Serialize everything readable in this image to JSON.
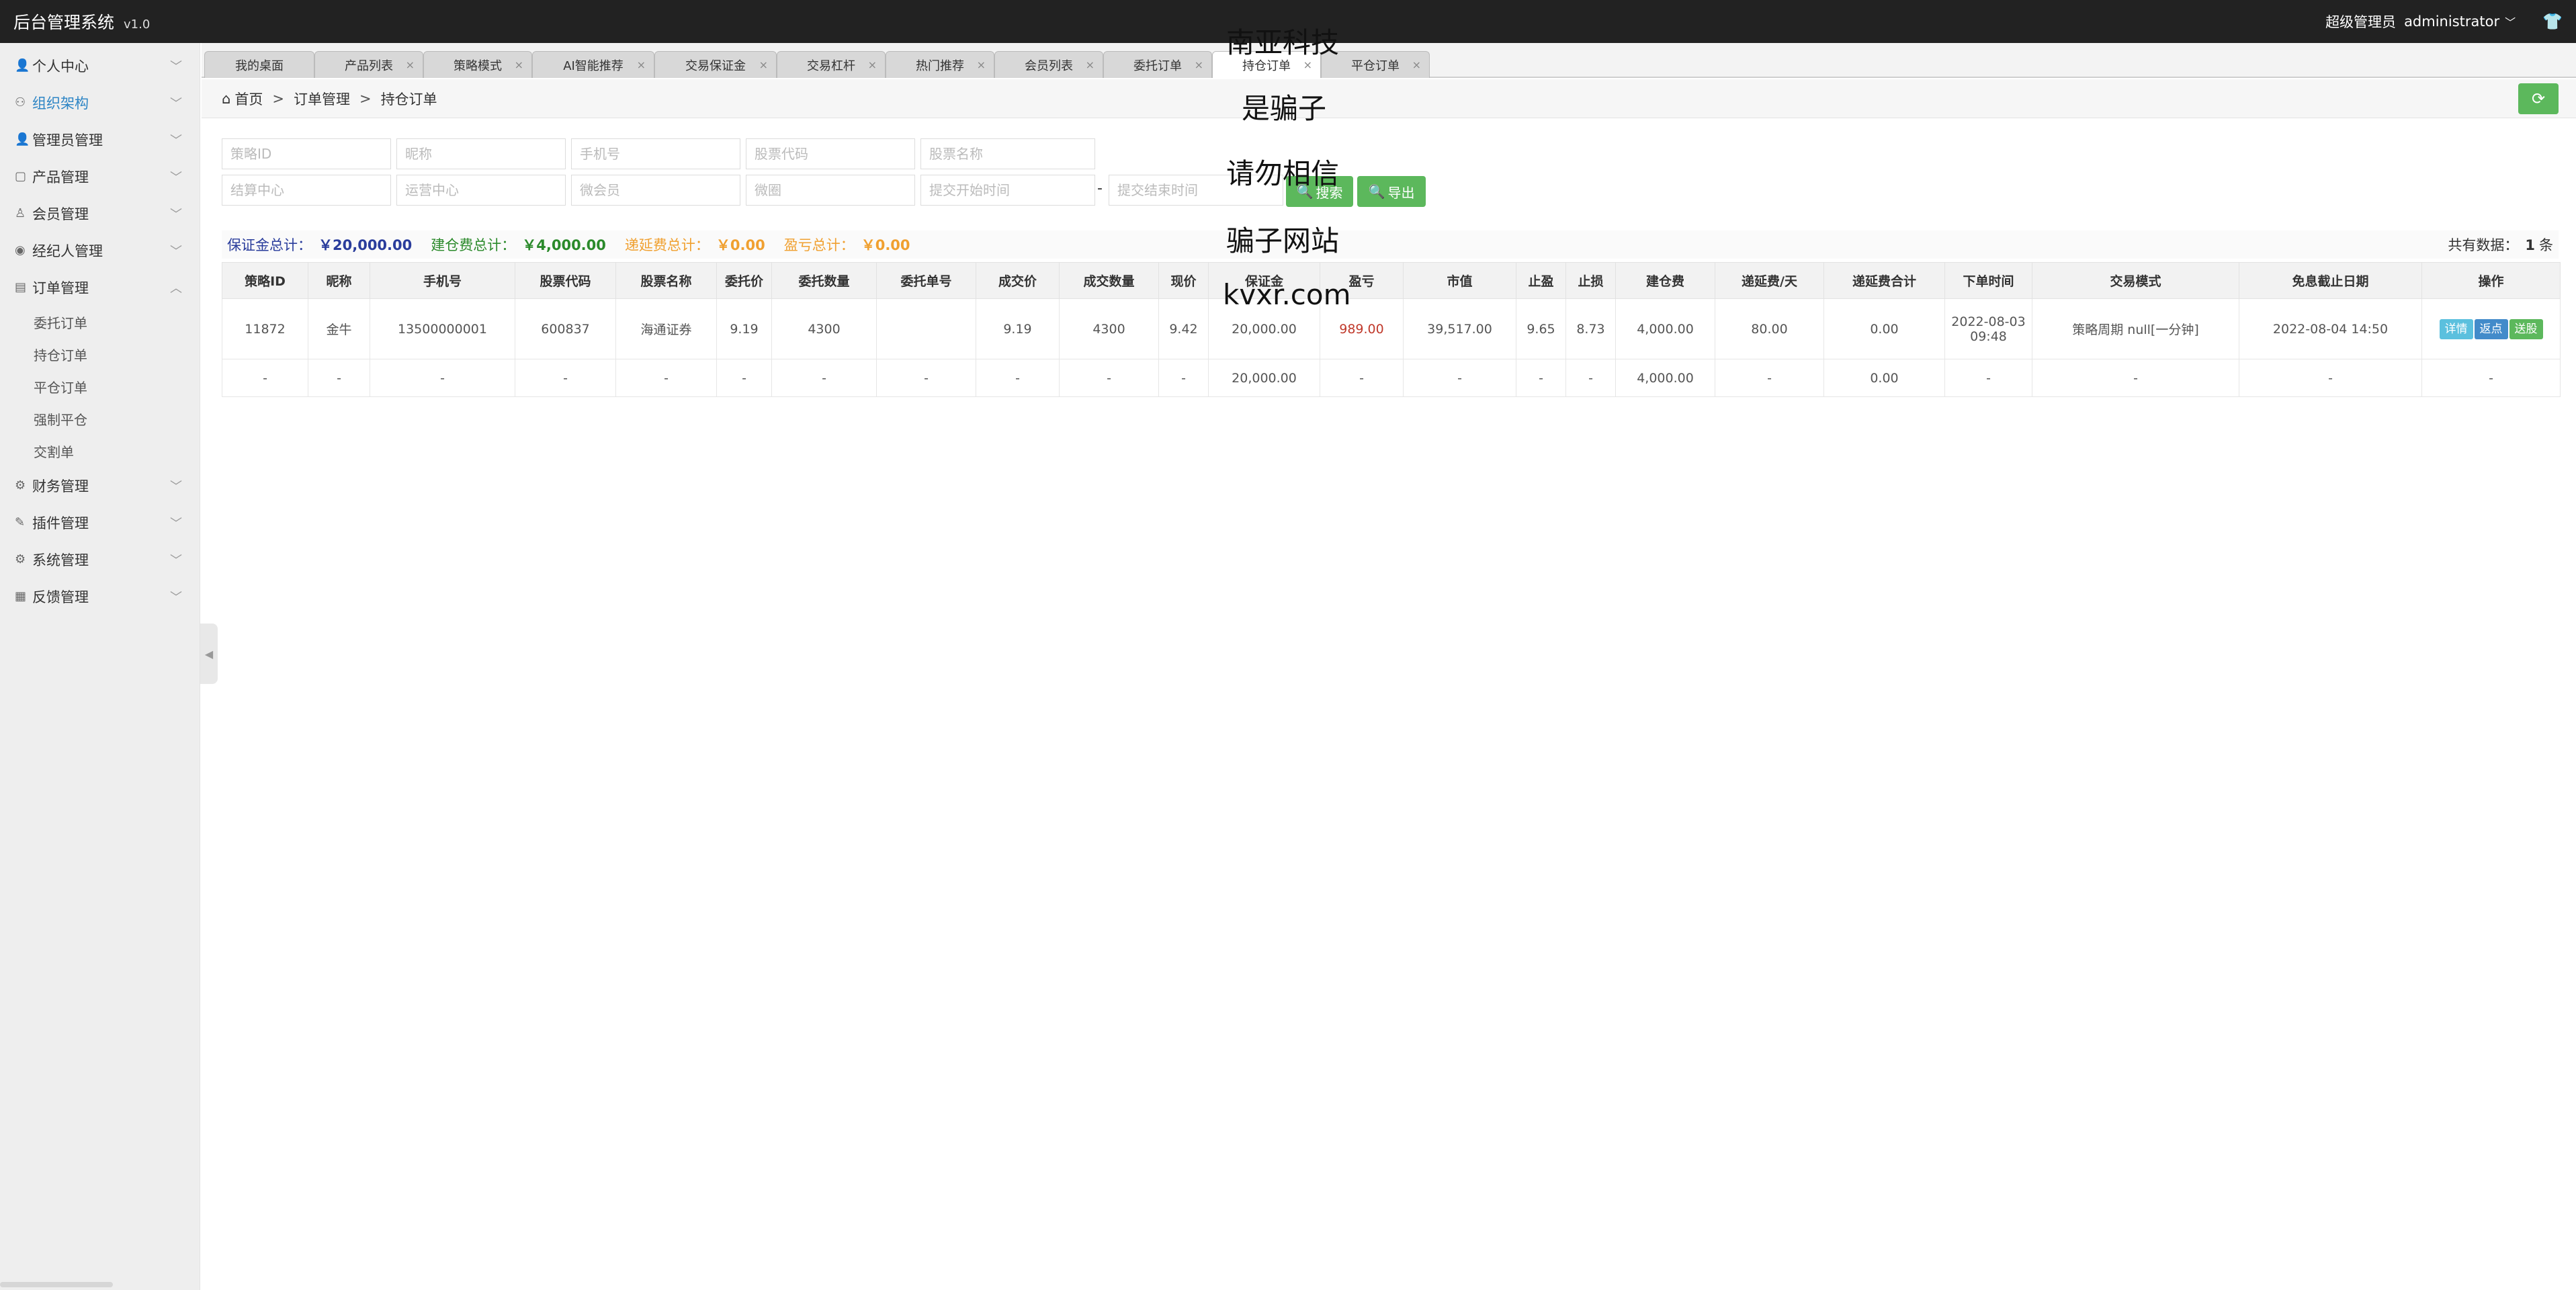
{
  "topbar": {
    "title": "后台管理系统",
    "version": "v1.0",
    "role": "超级管理员",
    "username": "administrator"
  },
  "sidebar": {
    "items": [
      {
        "label": "个人中心",
        "icon": "person-icon",
        "arrow": "﹀"
      },
      {
        "label": "组织架构",
        "icon": "org-icon",
        "arrow": "﹀",
        "active": true
      },
      {
        "label": "管理员管理",
        "icon": "person-icon",
        "arrow": "﹀"
      },
      {
        "label": "产品管理",
        "icon": "briefcase-icon",
        "arrow": "﹀"
      },
      {
        "label": "会员管理",
        "icon": "person-icon",
        "arrow": "﹀"
      },
      {
        "label": "经纪人管理",
        "icon": "eye-icon",
        "arrow": "﹀"
      },
      {
        "label": "订单管理",
        "icon": "order-icon",
        "arrow": "︿"
      }
    ],
    "order_sub": [
      "委托订单",
      "持仓订单",
      "平仓订单",
      "强制平仓",
      "交割单"
    ],
    "items_after": [
      {
        "label": "财务管理",
        "icon": "gear-icon",
        "arrow": "﹀"
      },
      {
        "label": "插件管理",
        "icon": "puzzle-icon",
        "arrow": "﹀"
      },
      {
        "label": "系统管理",
        "icon": "gear-icon",
        "arrow": "﹀"
      },
      {
        "label": "反馈管理",
        "icon": "feedback-icon",
        "arrow": "﹀"
      }
    ]
  },
  "tabs": [
    "我的桌面",
    "产品列表",
    "策略模式",
    "AI智能推荐",
    "交易保证金",
    "交易杠杆",
    "热门推荐",
    "会员列表",
    "委托订单",
    "持仓订单",
    "平仓订单"
  ],
  "breadcrumb": {
    "home": "首页",
    "level1": "订单管理",
    "level2": "持仓订单"
  },
  "filters": {
    "row1": [
      "策略ID",
      "昵称",
      "手机号",
      "股票代码",
      "股票名称"
    ],
    "row2": [
      "结算中心",
      "运营中心",
      "微会员",
      "微圈",
      "提交开始时间"
    ],
    "end_time": "提交结束时间",
    "search": "搜索",
    "export": "导出"
  },
  "summary": {
    "margin_label": "保证金总计：",
    "margin_value": "￥20,000.00",
    "build_label": "建仓费总计：",
    "build_value": "￥4,000.00",
    "defer_label": "递延费总计：",
    "defer_value": "￥0.00",
    "pnl_label": "盈亏总计：",
    "pnl_value": "￥0.00",
    "count_prefix": "共有数据：",
    "count": "1",
    "count_suffix": "条"
  },
  "table": {
    "headers": [
      "策略ID",
      "昵称",
      "手机号",
      "股票代码",
      "股票名称",
      "委托价",
      "委托数量",
      "委托单号",
      "成交价",
      "成交数量",
      "现价",
      "保证金",
      "盈亏",
      "市值",
      "止盈",
      "止损",
      "建仓费",
      "递延费/天",
      "递延费合计",
      "下单时间",
      "交易模式",
      "免息截止日期",
      "操作"
    ],
    "row": [
      "11872",
      "金牛",
      "13500000001",
      "600837",
      "海通证券",
      "9.19",
      "4300",
      "",
      "9.19",
      "4300",
      "9.42",
      "20,000.00",
      "989.00",
      "39,517.00",
      "9.65",
      "8.73",
      "4,000.00",
      "80.00",
      "0.00",
      "2022-08-03 09:48",
      "策略周期 null[一分钟]",
      "2022-08-04 14:50"
    ],
    "ops": {
      "detail": "详情",
      "rebate": "返点",
      "send": "送股"
    },
    "total_row": [
      "-",
      "-",
      "-",
      "-",
      "-",
      "-",
      "-",
      "-",
      "-",
      "-",
      "-",
      "20,000.00",
      "-",
      "-",
      "-",
      "-",
      "4,000.00",
      "-",
      "0.00",
      "-",
      "-",
      "-",
      "-"
    ]
  },
  "watermark": {
    "line1": "南亚科技",
    "line2": "是骗子",
    "line3": "请勿相信",
    "line4": "骗子网站",
    "line5": "kvxr.com"
  }
}
